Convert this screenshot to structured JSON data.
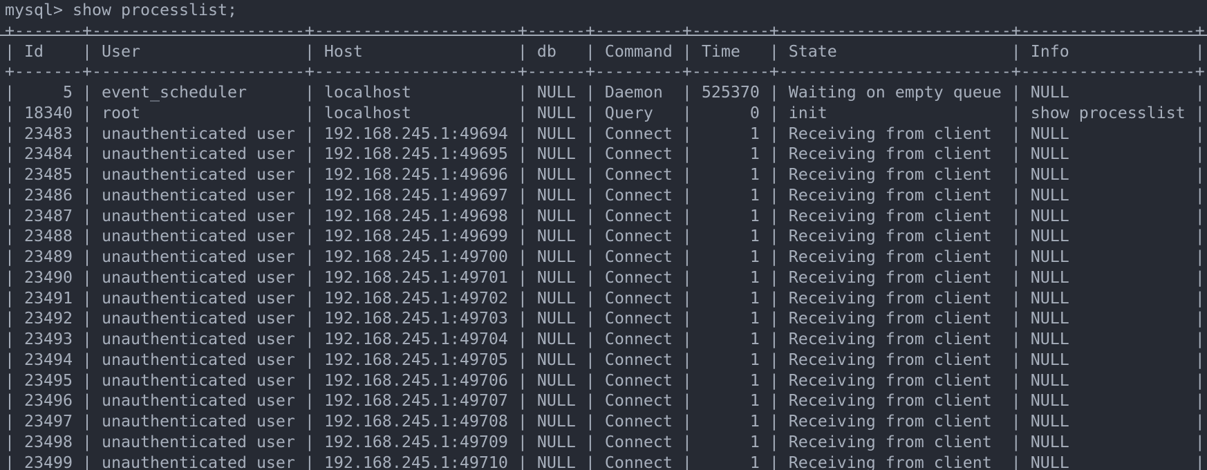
{
  "terminal": {
    "prompt_line": "mysql> show processlist;"
  },
  "colors": {
    "background": "#262a33",
    "foreground": "#a7afbc",
    "separator_line": "#a2aab6"
  },
  "processlist_table": {
    "columns": [
      "Id",
      "User",
      "Host",
      "db",
      "Command",
      "Time",
      "State",
      "Info"
    ],
    "right_aligned_columns": [
      "Id",
      "Time"
    ],
    "rows": [
      [
        "5",
        "event_scheduler",
        "localhost",
        "NULL",
        "Daemon",
        "525370",
        "Waiting on empty queue",
        "NULL"
      ],
      [
        "18340",
        "root",
        "localhost",
        "NULL",
        "Query",
        "0",
        "init",
        "show processlist"
      ],
      [
        "23483",
        "unauthenticated user",
        "192.168.245.1:49694",
        "NULL",
        "Connect",
        "1",
        "Receiving from client",
        "NULL"
      ],
      [
        "23484",
        "unauthenticated user",
        "192.168.245.1:49695",
        "NULL",
        "Connect",
        "1",
        "Receiving from client",
        "NULL"
      ],
      [
        "23485",
        "unauthenticated user",
        "192.168.245.1:49696",
        "NULL",
        "Connect",
        "1",
        "Receiving from client",
        "NULL"
      ],
      [
        "23486",
        "unauthenticated user",
        "192.168.245.1:49697",
        "NULL",
        "Connect",
        "1",
        "Receiving from client",
        "NULL"
      ],
      [
        "23487",
        "unauthenticated user",
        "192.168.245.1:49698",
        "NULL",
        "Connect",
        "1",
        "Receiving from client",
        "NULL"
      ],
      [
        "23488",
        "unauthenticated user",
        "192.168.245.1:49699",
        "NULL",
        "Connect",
        "1",
        "Receiving from client",
        "NULL"
      ],
      [
        "23489",
        "unauthenticated user",
        "192.168.245.1:49700",
        "NULL",
        "Connect",
        "1",
        "Receiving from client",
        "NULL"
      ],
      [
        "23490",
        "unauthenticated user",
        "192.168.245.1:49701",
        "NULL",
        "Connect",
        "1",
        "Receiving from client",
        "NULL"
      ],
      [
        "23491",
        "unauthenticated user",
        "192.168.245.1:49702",
        "NULL",
        "Connect",
        "1",
        "Receiving from client",
        "NULL"
      ],
      [
        "23492",
        "unauthenticated user",
        "192.168.245.1:49703",
        "NULL",
        "Connect",
        "1",
        "Receiving from client",
        "NULL"
      ],
      [
        "23493",
        "unauthenticated user",
        "192.168.245.1:49704",
        "NULL",
        "Connect",
        "1",
        "Receiving from client",
        "NULL"
      ],
      [
        "23494",
        "unauthenticated user",
        "192.168.245.1:49705",
        "NULL",
        "Connect",
        "1",
        "Receiving from client",
        "NULL"
      ],
      [
        "23495",
        "unauthenticated user",
        "192.168.245.1:49706",
        "NULL",
        "Connect",
        "1",
        "Receiving from client",
        "NULL"
      ],
      [
        "23496",
        "unauthenticated user",
        "192.168.245.1:49707",
        "NULL",
        "Connect",
        "1",
        "Receiving from client",
        "NULL"
      ],
      [
        "23497",
        "unauthenticated user",
        "192.168.245.1:49708",
        "NULL",
        "Connect",
        "1",
        "Receiving from client",
        "NULL"
      ],
      [
        "23498",
        "unauthenticated user",
        "192.168.245.1:49709",
        "NULL",
        "Connect",
        "1",
        "Receiving from client",
        "NULL"
      ],
      [
        "23499",
        "unauthenticated user",
        "192.168.245.1:49710",
        "NULL",
        "Connect",
        "1",
        "Receiving from client",
        "NULL"
      ]
    ]
  }
}
